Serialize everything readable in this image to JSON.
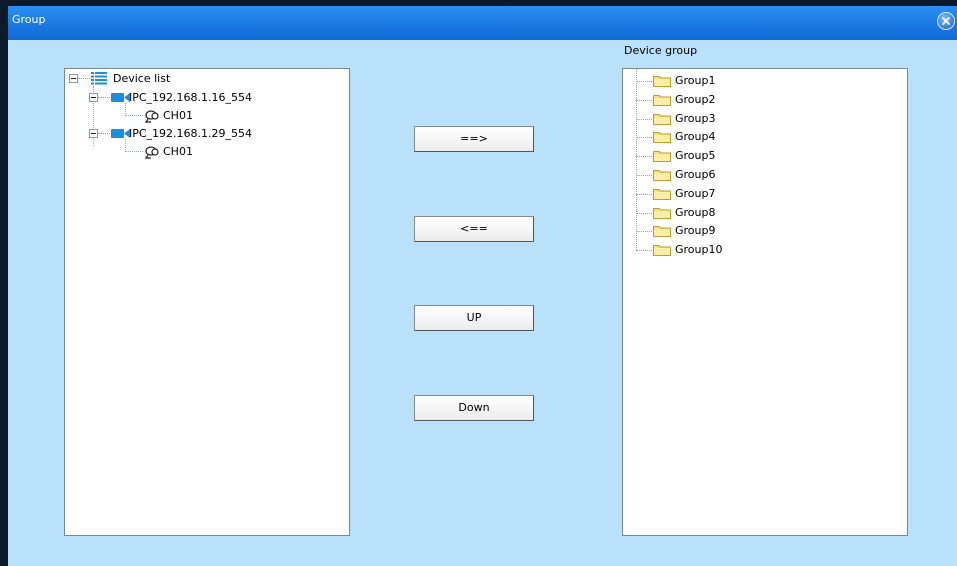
{
  "window": {
    "title": "Group"
  },
  "device_group_heading": "Device group",
  "device_tree": {
    "root": "Device list",
    "devices": [
      {
        "name": "IPC_192.168.1.16_554",
        "channel": "CH01"
      },
      {
        "name": "IPC_192.168.1.29_554",
        "channel": "CH01"
      }
    ]
  },
  "groups": [
    "Group1",
    "Group2",
    "Group3",
    "Group4",
    "Group5",
    "Group6",
    "Group7",
    "Group8",
    "Group9",
    "Group10"
  ],
  "buttons": {
    "add": "==>",
    "remove": "<==",
    "up": "UP",
    "down": "Down"
  },
  "icons": {
    "device_list": "list-icon",
    "device": "camera-icon",
    "channel": "cctv-icon",
    "group": "folder-icon",
    "close": "close-icon"
  },
  "colors": {
    "titlebar": "#1a79e3",
    "background": "#b9e1fa",
    "camera": "#1a8ee0",
    "folder": "#f5e27a"
  }
}
